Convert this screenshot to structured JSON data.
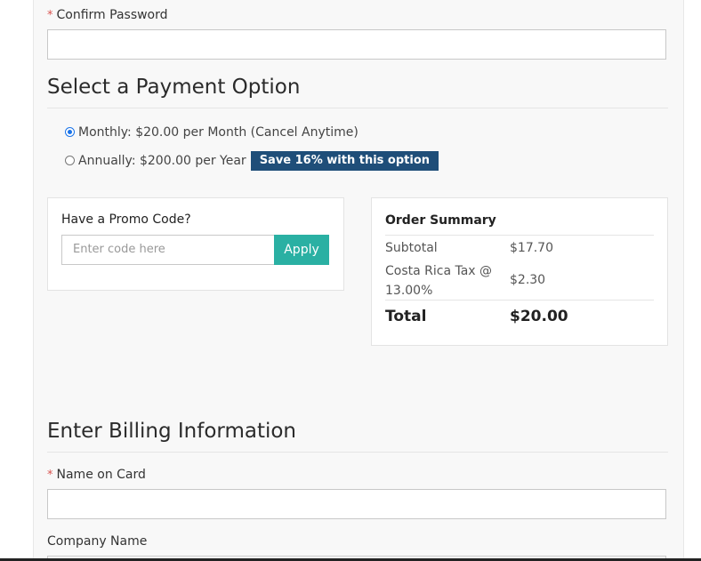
{
  "confirm_password": {
    "required_mark": "*",
    "label": "Confirm Password",
    "value": ""
  },
  "payment": {
    "title": "Select a Payment Option",
    "options": [
      {
        "label": "Monthly: $20.00 per Month (Cancel Anytime)",
        "selected": true
      },
      {
        "label": "Annually: $200.00 per Year",
        "selected": false,
        "badge": "Save 16% with this option"
      }
    ]
  },
  "promo": {
    "title": "Have a Promo Code?",
    "placeholder": "Enter code here",
    "apply_label": "Apply"
  },
  "order_summary": {
    "title": "Order Summary",
    "subtotal_label": "Subtotal",
    "subtotal_value": "$17.70",
    "tax_label_line1": "Costa Rica Tax @",
    "tax_label_line2": "13.00%",
    "tax_value": "$2.30",
    "total_label": "Total",
    "total_value": "$20.00"
  },
  "billing": {
    "title": "Enter Billing Information",
    "name_on_card": {
      "required_mark": "*",
      "label": "Name on Card",
      "value": ""
    },
    "company_name": {
      "label": "Company Name"
    }
  },
  "colors": {
    "accent_teal": "#2ab0a3",
    "badge_navy": "#1f4e79",
    "required_red": "#d9534f",
    "radio_blue": "#1a73e8"
  }
}
